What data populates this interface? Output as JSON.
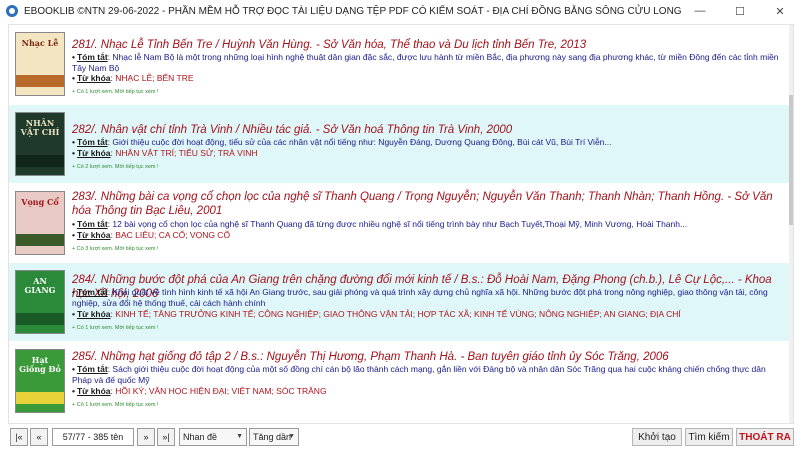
{
  "window": {
    "title": "EBOOKLIB ©NTN 29-06-2022 - PHẦN MỀM HỖ TRỢ ĐỌC TÀI LIỆU DẠNG TỆP PDF CÓ KIỂM SOÁT - ĐỊA CHÍ ĐỒNG BẰNG SÔNG CỬU LONG",
    "min_glyph": "—",
    "max_glyph": "☐",
    "close_glyph": "✕"
  },
  "labels": {
    "summary": "Tóm tắt",
    "keywords": "Từ khóa"
  },
  "records": [
    {
      "title": "281/. Nhạc Lễ Tỉnh Bến Tre / Huỳnh Văn Hùng. - Sở Văn hóa, Thể thao và Du lịch tỉnh Bến Tre, 2013",
      "summary": "Nhạc lễ Nam Bộ là một trong những loại hình nghệ thuật dân gian đặc sắc, được lưu hành từ miền Bắc, địa phương này sang địa phương khác, từ miền Đông đến các tỉnh miền Tây Nam Bộ",
      "keywords": "NHẠC LỄ; BẾN TRE",
      "note": "+ Có 1 lượt xem. Mời tiếp tục xem !",
      "cover_text": "Nhạc Lễ",
      "cover_bg": "#f3e4c2",
      "cover_band": "#b86a2a",
      "cover_fg": "#7a2a10"
    },
    {
      "title": "282/. Nhân vật chí tỉnh Trà Vinh / Nhiều tác giả. - Sở Văn hoá Thông tin Trà Vinh, 2000",
      "summary": "Giới thiệu cuộc đời hoạt động, tiểu sử của các nhân vật nổi tiếng như: Nguyễn Đáng, Dương Quang Đông, Bùi cát Vũ, Bùi Trí Viễn...",
      "keywords": "NHÂN VẬT TRÍ; TIỂU SỬ; TRÀ VINH",
      "note": "+ Có 2 lượt xem. Mời tiếp tục xem !",
      "cover_text": "NHÂN VẬT CHÍ",
      "cover_bg": "#1f3a2a",
      "cover_band": "#0f2618",
      "cover_fg": "#e8e0c0"
    },
    {
      "title": "283/. Những bài ca vọng cổ chọn lọc của nghệ sĩ Thanh Quang / Trọng Nguyễn; Nguyễn Văn Thanh; Thanh Nhàn; Thanh Hồng. - Sở Văn hóa Thông tin Bạc Liêu, 2001",
      "summary": "12 bài vọng cổ chọn lọc của nghệ sĩ Thanh Quang đã từng được nhiều nghệ sĩ nổi tiếng trình bày như Bạch Tuyết,Thoại Mỹ, Minh Vương, Hoài Thanh...",
      "keywords": "BẠC LIÊU; CA CỔ; VỌNG CỔ",
      "note": "+ Có 3 lượt xem. Mời tiếp tục xem !",
      "cover_text": "Vọng Cổ",
      "cover_bg": "#e9c9c4",
      "cover_band": "#3a5a2a",
      "cover_fg": "#a0181c"
    },
    {
      "title": "284/. Những bước đột phá của An Giang trên chặng đường đổi mới kinh tế / B.s.: Đỗ Hoài Nam, Đặng Phong (ch.b.), Lê Cự Lộc,... - Khoa học Xã hội, 2006",
      "summary": "Khái quát về tình hình kinh tế xã hội An Giang trước, sau giải phóng và quá trình xây dựng chủ nghĩa xã hội. Những bước đột phá trong nông nghiệp, giao thông vận tải, công nghiệp, sửa đổi hệ thống thuế, cải cách hành chính",
      "keywords": "KINH TẾ; TĂNG TRƯỞNG KINH TẾ; CÔNG NGHIỆP; GIAO THÔNG VẬN TẢI; HỢP TÁC XÃ; KINH TẾ VÙNG; NÔNG NGHIỆP; AN GIANG; ĐỊA CHÍ",
      "note": "+ Có 1 lượt xem. Mời tiếp tục xem !",
      "cover_text": "AN GIANG",
      "cover_bg": "#2a8a3a",
      "cover_band": "#1a5a26",
      "cover_fg": "#ffffff"
    },
    {
      "title": "285/. Những hạt giống đỏ tập 2 / B.s.: Nguyễn Thị Hương, Phạm Thanh Hà. - Ban tuyên giáo tỉnh ủy Sóc Trăng, 2006",
      "summary": "Sách giới thiệu cuộc đời hoạt động của một số đồng chí cán bộ lão thành cách mạng, gắn liền với Đảng bộ và nhân dân Sóc Trăng qua hai cuộc kháng chiến chống thực dân Pháp và đế quốc Mỹ",
      "keywords": "HỒI KÝ; VĂN HỌC HIỆN ĐẠI; VIỆT NAM; SÓC TRĂNG",
      "note": "+ Có 1 lượt xem. Mời tiếp tục xem !",
      "cover_text": "Hạt Giống Đỏ",
      "cover_bg": "#3a9a3a",
      "cover_band": "#e8d23a",
      "cover_fg": "#ffffff"
    }
  ],
  "pager": {
    "first": "|«",
    "prev": "«",
    "page_info": "57/77 - 385 tên",
    "next": "»",
    "last": "»|",
    "sort_field": "Nhan đề",
    "sort_order": "Tăng dần"
  },
  "actions": {
    "home": "Khởi tạo",
    "search": "Tìm kiếm",
    "exit": "THOÁT RA"
  },
  "colors": {
    "title_red": "#a3121b",
    "alt_row": "#dff7f9",
    "exit_red": "#c0141c"
  }
}
